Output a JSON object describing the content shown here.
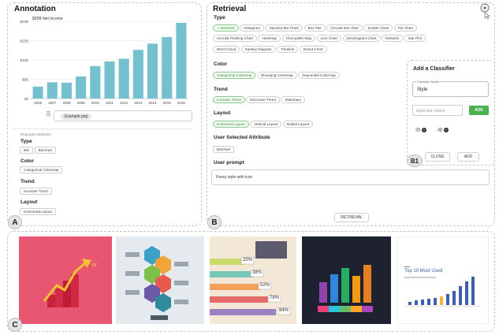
{
  "panel_a": {
    "title": "Annotation",
    "badge": "A",
    "chart_caption": "$20B Net Income",
    "file_name": "Example.png",
    "requisite_header": "Requisite attributes",
    "sections": [
      {
        "label": "Type",
        "tags": [
          "Bar",
          "Barchart"
        ]
      },
      {
        "label": "Color",
        "tags": [
          "Categorical Colormap"
        ]
      },
      {
        "label": "Trend",
        "tags": [
          "Increase Trend"
        ]
      },
      {
        "label": "Layout",
        "tags": [
          "Horizontal Layout"
        ]
      }
    ]
  },
  "chart_data": {
    "type": "bar",
    "title": "$20B Net Income",
    "categories": [
      "2006",
      "2007",
      "2008",
      "2009",
      "2010",
      "2011",
      "2012",
      "2013",
      "2014",
      "2015",
      "2016"
    ],
    "values": [
      3.1,
      4.2,
      4.1,
      5.7,
      8.4,
      9.6,
      10.3,
      12.6,
      14.2,
      15.9,
      19.6
    ],
    "ytick_labels": [
      "$0",
      "$5B",
      "$10B",
      "$15B",
      "$20B"
    ],
    "ylim": [
      0,
      20
    ],
    "bar_color": "#74c0cf",
    "grid": true
  },
  "panel_b": {
    "title": "Retrieval",
    "badge": "B",
    "type_label": "Type",
    "type_tags": [
      [
        "Barchart",
        "Histogram",
        "Stacked Bar Chart",
        "Box Plot",
        "Circular Bar chart",
        "Scatter Chart",
        "Pie Chart"
      ],
      [
        "Circular Packing Chart",
        "Heatmap",
        "Choropleth Map",
        "Line Chart",
        "Dendrogram Chart",
        "Network",
        "Star Plot"
      ],
      [
        "Word Cloud",
        "Sankey Diagram",
        "Timeline",
        "Donut Chart"
      ]
    ],
    "type_selected": "Barchart",
    "color_label": "Color",
    "color_tags": [
      "Categorical Colormap",
      "Diverging Colormap",
      "Sequential Colormap"
    ],
    "color_selected": "Categorical Colormap",
    "trend_label": "Trend",
    "trend_tags": [
      "Increase Trend",
      "Decrease Trend",
      "Stationary"
    ],
    "trend_selected": "Increase Trend",
    "layout_label": "Layout",
    "layout_tags": [
      "Horizontal Layout",
      "Vertical Layout",
      "Radial Layout"
    ],
    "layout_selected": "Horizontal Layout",
    "user_attr_label": "User Selected Attribute",
    "user_attr_tags": [
      "Barchart"
    ],
    "prompt_label": "User prompt",
    "prompt_value": "Fancy style with icon",
    "retrieval_button": "RETRIEVAL",
    "add_icon": "plus-circle-icon",
    "cursor_icon": "cursor-icon"
  },
  "popup": {
    "badge": "B1",
    "title": "Add a Classifier",
    "field_label": "Classifier Name",
    "field_value": "Style",
    "choice_placeholder": "input one choice",
    "add_small": "ADD",
    "chips": [
      "2D",
      "3D"
    ],
    "close_button": "CLOSE",
    "add_button": "ADD"
  },
  "panel_c": {
    "badge": "C",
    "thumbnails": [
      {
        "name": "pink-bar-arrow-infographic"
      },
      {
        "name": "hexagon-steps-infographic"
      },
      {
        "name": "ribbon-percentage-infographic",
        "labels": [
          "25%",
          "38%",
          "52%",
          "78%",
          "84%"
        ]
      },
      {
        "name": "cylinder-bar-infographic"
      },
      {
        "name": "top10-bar-chart",
        "title": "Top 10 Most Used"
      }
    ]
  },
  "colors": {
    "accent_green": "#3c8f3c",
    "bar_teal": "#74c0cf",
    "add_green": "#4caf50"
  }
}
